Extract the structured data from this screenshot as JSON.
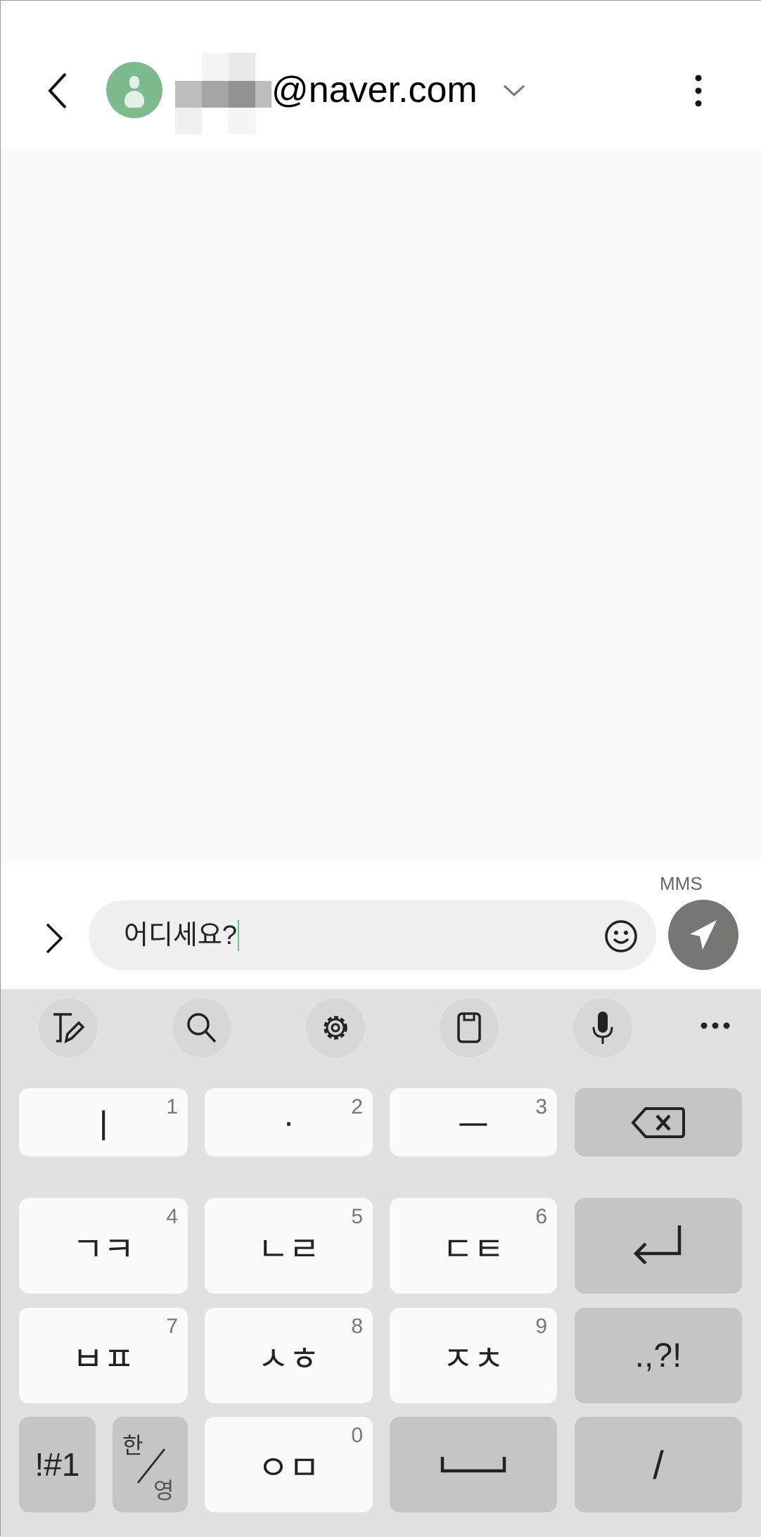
{
  "header": {
    "email_suffix": "@naver.com",
    "avatar_color": "#7dbb8f"
  },
  "compose": {
    "expand_icon": "chevron-right-icon",
    "message_type": "MMS",
    "input_value": "어디세요?",
    "send_color": "#767672"
  },
  "keyboard": {
    "toolbar": [
      "text-edit-icon",
      "search-icon",
      "settings-icon",
      "clipboard-icon",
      "microphone-icon",
      "more-icon"
    ],
    "rows": [
      [
        {
          "label": "ㅣ",
          "num": "1"
        },
        {
          "label": "·",
          "num": "2"
        },
        {
          "label": "ㅡ",
          "num": "3"
        },
        {
          "label": "",
          "icon": "backspace-icon"
        }
      ],
      [
        {
          "label": "ㄱㅋ",
          "num": "4"
        },
        {
          "label": "ㄴㄹ",
          "num": "5"
        },
        {
          "label": "ㄷㅌ",
          "num": "6"
        },
        {
          "label": "",
          "icon": "enter-icon"
        }
      ],
      [
        {
          "label": "ㅂㅍ",
          "num": "7"
        },
        {
          "label": "ㅅㅎ",
          "num": "8"
        },
        {
          "label": "ㅈㅊ",
          "num": "9"
        },
        {
          "label": ".,?!"
        }
      ],
      [
        {
          "label": "!#1"
        },
        {
          "label_top": "한",
          "label_bottom": "영"
        },
        {
          "label": "ㅇㅁ",
          "num": "0"
        },
        {
          "label": "",
          "icon": "space-icon"
        },
        {
          "label": "/"
        }
      ]
    ]
  }
}
